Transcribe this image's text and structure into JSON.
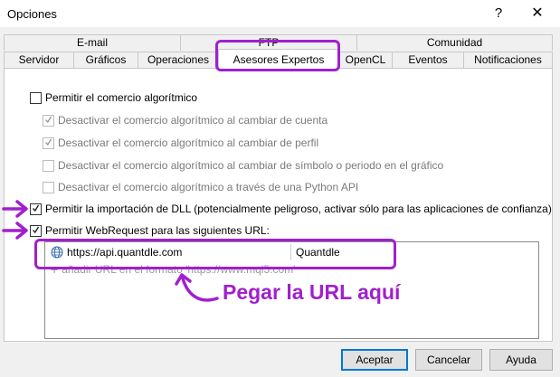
{
  "window": {
    "title": "Opciones",
    "help_glyph": "?",
    "close_glyph": "✕"
  },
  "tabs": {
    "row_top": [
      "E-mail",
      "FTP",
      "Comunidad"
    ],
    "row_bottom": [
      "Servidor",
      "Gráficos",
      "Operaciones",
      "Asesores Expertos",
      "OpenCL",
      "Eventos",
      "Notificaciones"
    ],
    "active": "Asesores Expertos"
  },
  "options": [
    {
      "label": "Permitir el comercio algorítmico",
      "checked": false,
      "enabled": true
    },
    {
      "label": "Desactivar el comercio algorítmico al cambiar de cuenta",
      "checked": true,
      "enabled": false
    },
    {
      "label": "Desactivar el comercio algorítmico al cambiar de perfil",
      "checked": true,
      "enabled": false
    },
    {
      "label": "Desactivar el comercio algorítmico al cambiar de símbolo o periodo en el gráfico",
      "checked": false,
      "enabled": false
    },
    {
      "label": "Desactivar el comercio algorítmico a través de una Python API",
      "checked": false,
      "enabled": false
    },
    {
      "label": "Permitir la importación de DLL (potencialmente peligroso, activar sólo para las aplicaciones de confianza)",
      "checked": true,
      "enabled": true
    },
    {
      "label": "Permitir WebRequest para las siguientes URL:",
      "checked": true,
      "enabled": true
    }
  ],
  "url_list": {
    "rows": [
      {
        "url": "https://api.quantdle.com",
        "name": "Quantdle"
      }
    ],
    "add_hint": "añadir URL en el formato 'https://www.mql5.com'"
  },
  "annotation": {
    "text": "Pegar la URL aquí",
    "color": "#a11fcf"
  },
  "buttons": {
    "accept": "Aceptar",
    "cancel": "Cancelar",
    "help": "Ayuda"
  }
}
